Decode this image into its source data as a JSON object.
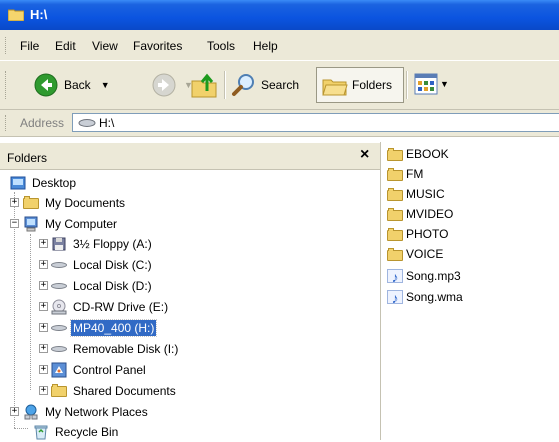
{
  "window": {
    "title": "H:\\"
  },
  "menu": [
    "File",
    "Edit",
    "View",
    "Favorites",
    "Tools",
    "Help"
  ],
  "toolbar": {
    "back_label": "Back",
    "search_label": "Search",
    "folders_label": "Folders"
  },
  "address": {
    "label": "Address",
    "value": "H:\\"
  },
  "folders_pane": {
    "title": "Folders",
    "close_label": "×",
    "items": [
      {
        "label": "Desktop",
        "icon": "desktop-icon"
      },
      {
        "label": "My Documents",
        "icon": "my-documents-icon",
        "expander": "+"
      },
      {
        "label": "My Computer",
        "icon": "my-computer-icon",
        "expander": "−"
      },
      {
        "label": "3½ Floppy (A:)",
        "icon": "floppy-drive-icon",
        "expander": "+"
      },
      {
        "label": "Local Disk (C:)",
        "icon": "hard-drive-icon",
        "expander": "+"
      },
      {
        "label": "Local Disk (D:)",
        "icon": "hard-drive-icon",
        "expander": "+"
      },
      {
        "label": "CD-RW Drive (E:)",
        "icon": "cd-drive-icon",
        "expander": "+"
      },
      {
        "label": "MP40_400 (H:)",
        "icon": "removable-drive-icon",
        "expander": "+",
        "selected": true
      },
      {
        "label": "Removable Disk (I:)",
        "icon": "removable-drive-icon",
        "expander": "+"
      },
      {
        "label": "Control Panel",
        "icon": "control-panel-icon",
        "expander": "+"
      },
      {
        "label": "Shared Documents",
        "icon": "folder-icon",
        "expander": "+"
      },
      {
        "label": "My Network Places",
        "icon": "network-places-icon",
        "expander": "+"
      },
      {
        "label": "Recycle Bin",
        "icon": "recycle-bin-icon"
      }
    ]
  },
  "files": [
    {
      "name": "EBOOK",
      "type": "folder"
    },
    {
      "name": "FM",
      "type": "folder"
    },
    {
      "name": "MUSIC",
      "type": "folder"
    },
    {
      "name": "MVIDEO",
      "type": "folder"
    },
    {
      "name": "PHOTO",
      "type": "folder"
    },
    {
      "name": "VOICE",
      "type": "folder"
    },
    {
      "name": "Song.mp3",
      "type": "audio"
    },
    {
      "name": "Song.wma",
      "type": "audio"
    }
  ],
  "colors": {
    "titlebar": "#0b54e0",
    "selection": "#316ac5",
    "chrome": "#ece9d8"
  }
}
